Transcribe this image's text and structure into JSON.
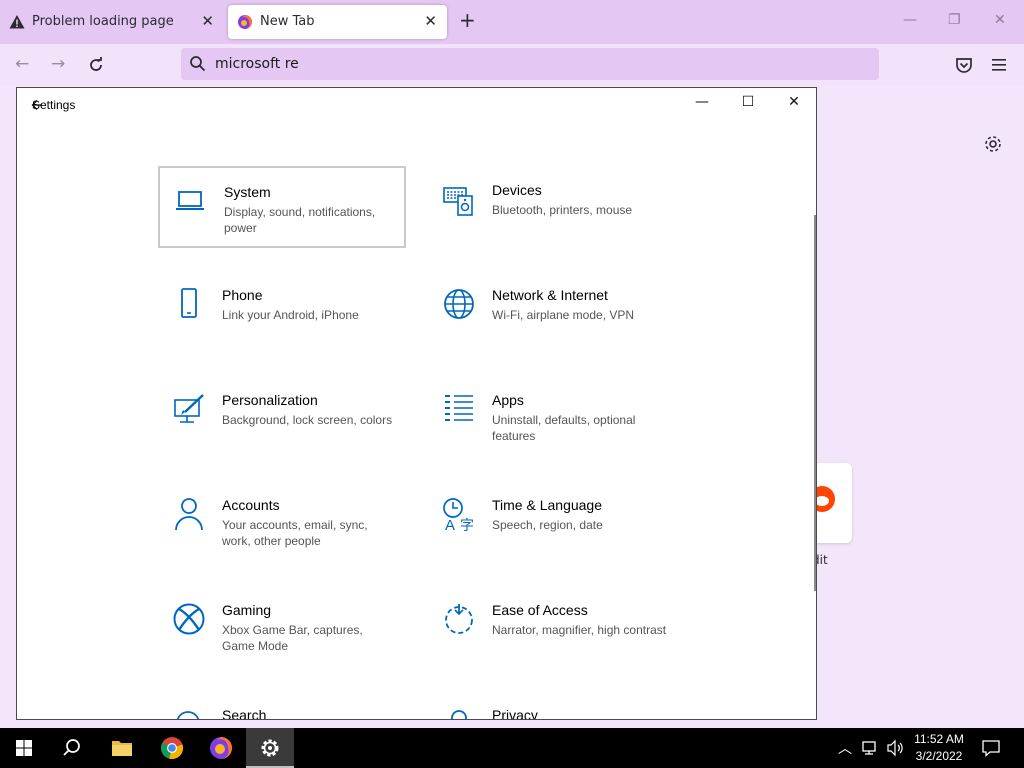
{
  "browser": {
    "tabs": [
      {
        "title": "Problem loading page",
        "icon": "warning-icon",
        "active": false
      },
      {
        "title": "New Tab",
        "icon": "firefox-icon",
        "active": true
      }
    ],
    "new_tab_symbol": "+",
    "url_value": "microsoft re",
    "window_controls": {
      "minimize": "—",
      "restore": "❐",
      "close": "✕"
    },
    "nav": {
      "back": "←",
      "forward": "→"
    },
    "background_tile_label": "dit"
  },
  "settings": {
    "window_title": "Settings",
    "controls": {
      "minimize": "—",
      "maximize": "☐",
      "close": "✕"
    },
    "accent": "#0067c0",
    "tiles": [
      {
        "name": "System",
        "desc": "Display, sound, notifications, power",
        "icon": "laptop-icon",
        "selected": true
      },
      {
        "name": "Devices",
        "desc": "Bluetooth, printers, mouse",
        "icon": "keyboard-speaker-icon",
        "selected": false
      },
      {
        "name": "Phone",
        "desc": "Link your Android, iPhone",
        "icon": "phone-icon",
        "selected": false
      },
      {
        "name": "Network & Internet",
        "desc": "Wi-Fi, airplane mode, VPN",
        "icon": "globe-icon",
        "selected": false
      },
      {
        "name": "Personalization",
        "desc": "Background, lock screen, colors",
        "icon": "paintbrush-icon",
        "selected": false
      },
      {
        "name": "Apps",
        "desc": "Uninstall, defaults, optional features",
        "icon": "apps-list-icon",
        "selected": false
      },
      {
        "name": "Accounts",
        "desc": "Your accounts, email, sync, work, other people",
        "icon": "person-icon",
        "selected": false
      },
      {
        "name": "Time & Language",
        "desc": "Speech, region, date",
        "icon": "time-language-icon",
        "selected": false
      },
      {
        "name": "Gaming",
        "desc": "Xbox Game Bar, captures, Game Mode",
        "icon": "xbox-icon",
        "selected": false
      },
      {
        "name": "Ease of Access",
        "desc": "Narrator, magnifier, high contrast",
        "icon": "ease-of-access-icon",
        "selected": false
      },
      {
        "name": "Search",
        "desc": "",
        "icon": "search-icon",
        "selected": false
      },
      {
        "name": "Privacy",
        "desc": "",
        "icon": "lock-icon",
        "selected": false
      }
    ]
  },
  "taskbar": {
    "items": [
      "windows-start-icon",
      "search-icon",
      "file-explorer-icon",
      "chrome-icon",
      "firefox-icon",
      "settings-gear-icon"
    ],
    "active_item": "settings-gear-icon",
    "clock": {
      "time": "11:52 AM",
      "date": "3/2/2022"
    }
  }
}
